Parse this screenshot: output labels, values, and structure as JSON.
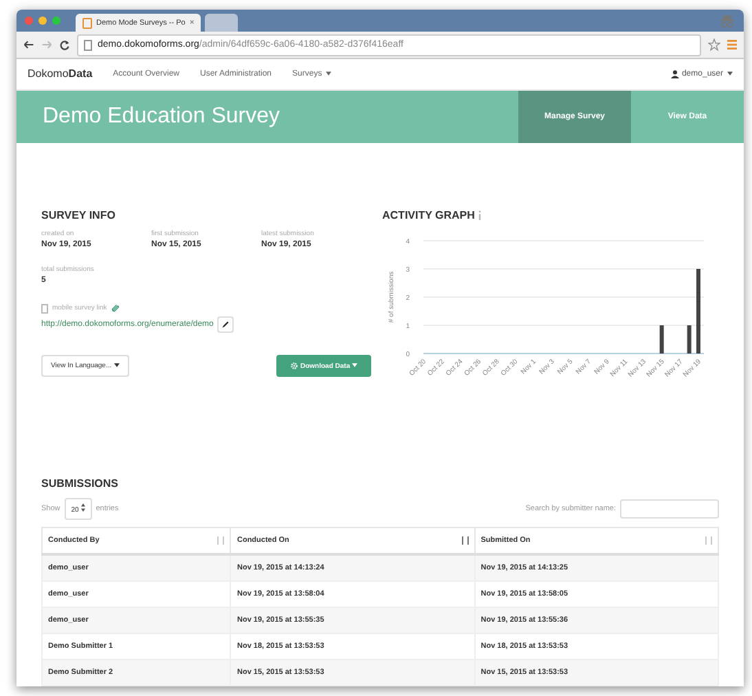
{
  "browser": {
    "tabs": [
      {
        "title": "Demo Mode Surveys -- Po",
        "close": "×",
        "selected": true
      },
      {
        "selected": false
      }
    ],
    "url_host": "demo.dokomoforms.org",
    "url_path": "/admin/64df659c-6a06-4180-a582-d376f416eaff"
  },
  "nav": {
    "brand": "Dokomo**Data**",
    "links": [
      {
        "label": "Account Overview",
        "dropdown": false
      },
      {
        "label": "User Administration",
        "dropdown": false
      },
      {
        "label": "Surveys",
        "dropdown": true
      }
    ],
    "user": "demo_user"
  },
  "banner": {
    "title": "Demo Education Survey",
    "actions": [
      {
        "label": "Manage Survey",
        "selected": true
      },
      {
        "label": "View Data",
        "selected": false
      }
    ]
  },
  "survey_info": {
    "heading": "SURVEY INFO",
    "stats": [
      {
        "label": "created on",
        "value": "Nov 19, 2015"
      },
      {
        "label": "first submission",
        "value": "Nov 15, 2015"
      },
      {
        "label": "latest submission",
        "value": "Nov 19, 2015"
      },
      {
        "label": "total submissions",
        "value": "5"
      }
    ],
    "mobile_link_label": "mobile survey link",
    "mobile_link": "http://demo.dokomoforms.org/enumerate/demo",
    "language_button": "View In Language...",
    "download_button": "Download Data"
  },
  "activity": {
    "heading": "ACTIVITY GRAPH",
    "chart_data": {
      "type": "bar",
      "ylabel": "# of submissions",
      "categories": [
        "Oct 20",
        null,
        "Oct 22",
        null,
        "Oct 24",
        null,
        "Oct 26",
        null,
        "Oct 28",
        null,
        "Oct 30",
        null,
        "Nov 1",
        null,
        "Nov 3",
        null,
        "Nov 5",
        null,
        "Nov 7",
        null,
        "Nov 9",
        null,
        "Nov 11",
        null,
        "Nov 13",
        null,
        "Nov 15",
        null,
        "Nov 17",
        null,
        "Nov 19"
      ],
      "values": [
        0,
        0,
        0,
        0,
        0,
        0,
        0,
        0,
        0,
        0,
        0,
        0,
        0,
        0,
        0,
        0,
        0,
        0,
        0,
        0,
        0,
        0,
        0,
        0,
        0,
        0,
        1,
        0,
        0,
        1,
        3
      ],
      "ylim": [
        0,
        4
      ],
      "yticks": [
        0,
        1,
        2,
        3,
        4
      ],
      "grid": true
    }
  },
  "submissions": {
    "heading": "SUBMISSIONS",
    "show_label": "Show",
    "page_size": "20",
    "entries_label": "entries",
    "search_label": "Search by submitter name:",
    "columns": [
      {
        "label": "Conducted By",
        "sorted": false
      },
      {
        "label": "Conducted On",
        "sorted": true
      },
      {
        "label": "Submitted On",
        "sorted": false
      }
    ],
    "rows": [
      [
        "demo_user",
        "Nov 19, 2015 at 14:13:24",
        "Nov 19, 2015 at 14:13:25"
      ],
      [
        "demo_user",
        "Nov 19, 2015 at 13:58:04",
        "Nov 19, 2015 at 13:58:05"
      ],
      [
        "demo_user",
        "Nov 19, 2015 at 13:55:35",
        "Nov 19, 2015 at 13:55:36"
      ],
      [
        "Demo Submitter 1",
        "Nov 18, 2015 at 13:53:53",
        "Nov 18, 2015 at 13:53:53"
      ],
      [
        "Demo Submitter 2",
        "Nov 15, 2015 at 13:53:53",
        "Nov 15, 2015 at 13:53:53"
      ]
    ]
  }
}
